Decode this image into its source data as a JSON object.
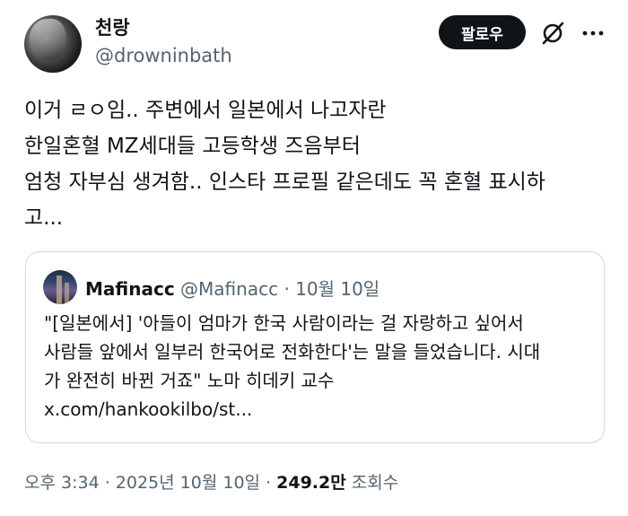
{
  "author": {
    "display_name": "천랑",
    "handle": "@drowninbath"
  },
  "actions": {
    "follow_label": "팔로우",
    "grok_icon": "grok-slash-icon",
    "more_icon": "more-dots-icon"
  },
  "tweet": {
    "lines": [
      "이거 ㄹㅇ임.. 주변에서 일본에서 나고자란",
      "한일혼혈 MZ세대들 고등학생 즈음부터",
      "엄청 자부심 생겨함.. 인스타 프로필 같은데도 꼭 혼혈 표시하",
      "고..."
    ]
  },
  "quoted": {
    "name": "Mafinacc",
    "handle": "@Mafinacc",
    "separator": "·",
    "date": "10월 10일",
    "lines": [
      "\"[일본에서] '아들이 엄마가 한국 사람이라는 걸 자랑하고 싶어서",
      "사람들 앞에서 일부러 한국어로 전화한다'는 말을 들었습니다. 시대",
      "가 완전히 바뀐 거죠\" 노마 히데키 교수",
      "x.com/hankookilbo/st..."
    ]
  },
  "footer": {
    "timestamp": "오후 3:34 · 2025년 10월 10일 · ",
    "views_count": "249.2만",
    "views_label": " 조회수"
  }
}
